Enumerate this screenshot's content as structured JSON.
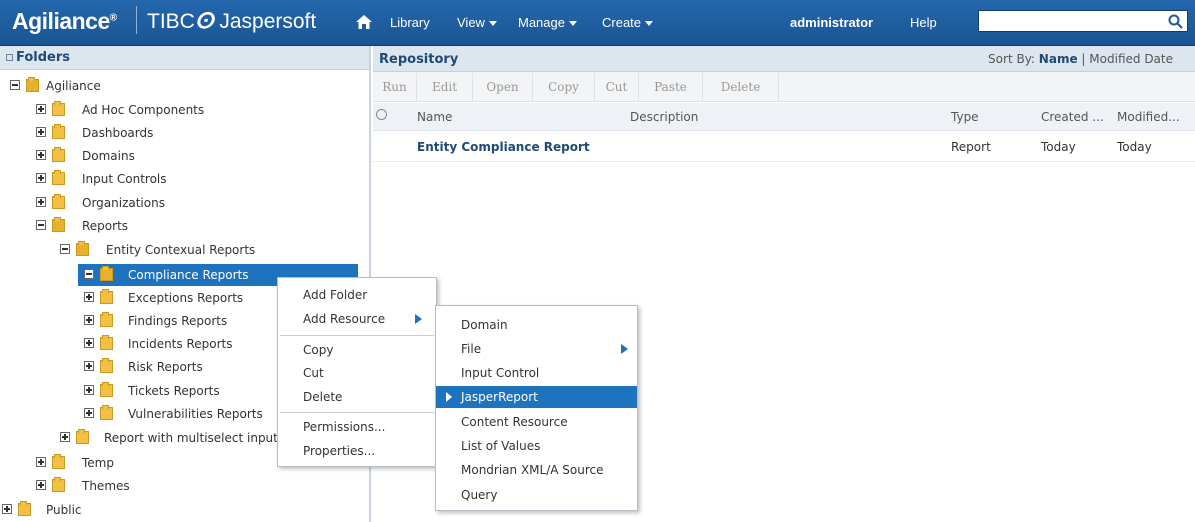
{
  "brand": {
    "product": "Agiliance",
    "tm": "®",
    "vendor": "TIBC",
    "vendor2": "Jaspersoft"
  },
  "nav": {
    "library": "Library",
    "view": "View",
    "manage": "Manage",
    "create": "Create",
    "user": "administrator",
    "help": "Help"
  },
  "search": {
    "value": "",
    "placeholder": ""
  },
  "folders": {
    "title": "Folders",
    "root": "Agiliance",
    "items": [
      "Ad Hoc Components",
      "Dashboards",
      "Domains",
      "Input Controls",
      "Organizations",
      "Reports"
    ],
    "reports_child": "Entity Contexual Reports",
    "selected": "Compliance Reports",
    "sub": [
      "Exceptions Reports",
      "Findings Reports",
      "Incidents Reports",
      "Risk Reports",
      "Tickets Reports",
      "Vulnerabilities Reports"
    ],
    "multiselect": "Report with multiselect input",
    "after": [
      "Temp",
      "Themes"
    ],
    "public": "Public"
  },
  "repository": {
    "title": "Repository",
    "sort_label": "Sort By:",
    "sort_name": "Name",
    "sort_sep": "|",
    "sort_modified": "Modified Date",
    "toolbar": [
      "Run",
      "Edit",
      "Open",
      "Copy",
      "Cut",
      "Paste",
      "Delete"
    ],
    "columns": {
      "name": "Name",
      "description": "Description",
      "type": "Type",
      "created": "Created ...",
      "modified": "Modified..."
    },
    "rows": [
      {
        "name": "Entity Compliance Report",
        "type": "Report",
        "created": "Today",
        "modified": "Today"
      }
    ]
  },
  "context_menu": {
    "items": [
      "Add Folder",
      "Add Resource",
      "Copy",
      "Cut",
      "Delete",
      "Permissions...",
      "Properties..."
    ]
  },
  "submenu": {
    "items": [
      "Domain",
      "File",
      "Input Control",
      "JasperReport",
      "Content Resource",
      "List of Values",
      "Mondrian XML/A Source",
      "Query"
    ],
    "highlighted": "JasperReport"
  }
}
